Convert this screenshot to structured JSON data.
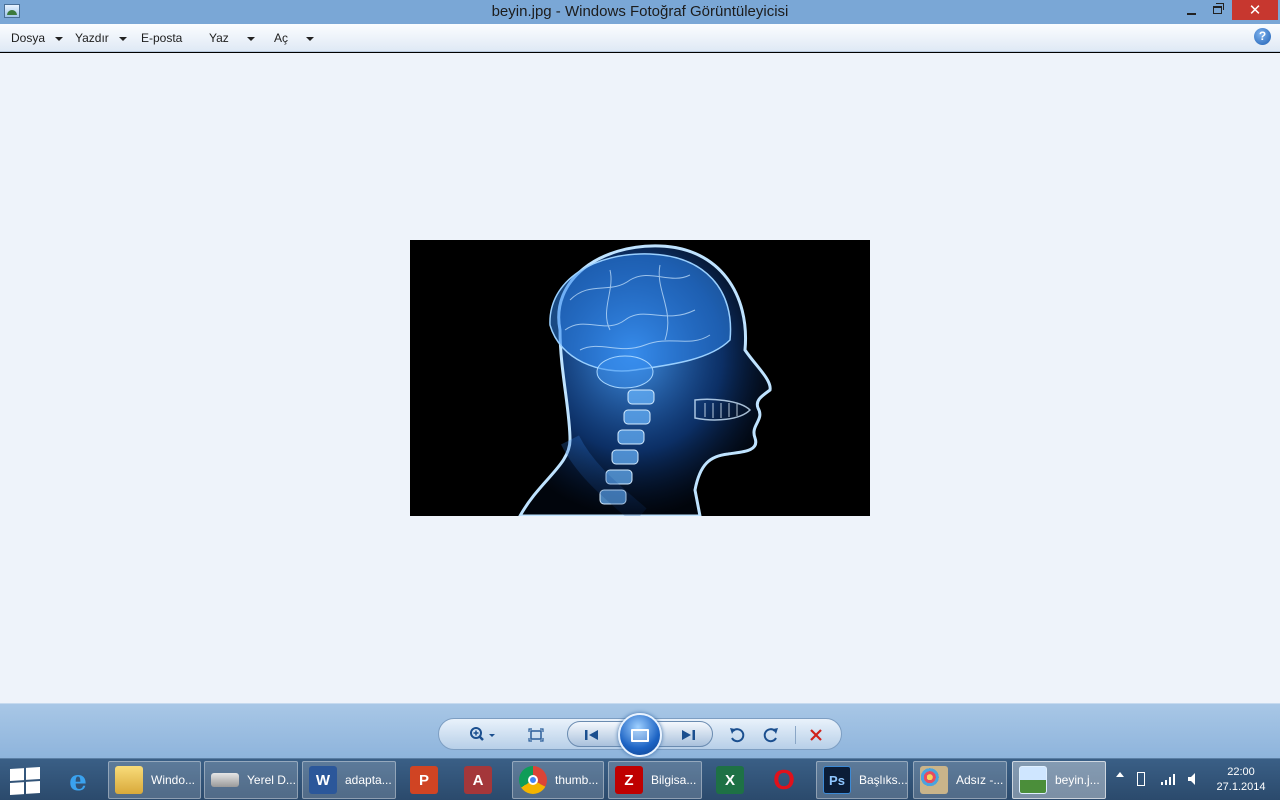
{
  "window": {
    "title": "beyin.jpg - Windows Fotoğraf Görüntüleyicisi",
    "icon": "photo-viewer-icon",
    "controls": [
      "minimize-icon",
      "restore-icon",
      "close-icon"
    ]
  },
  "menu": {
    "items": [
      {
        "label": "Dosya",
        "has_dropdown": true
      },
      {
        "label": "Yazdır",
        "has_dropdown": true
      },
      {
        "label": "E-posta",
        "has_dropdown": false
      },
      {
        "label": "Yaz",
        "has_dropdown": true
      },
      {
        "label": "Aç",
        "has_dropdown": true
      }
    ],
    "help_icon": "help-icon",
    "help_glyph": "?"
  },
  "image": {
    "subject": "x-ray-head-brain"
  },
  "controls": {
    "buttons": [
      "zoom-icon",
      "actual-size-icon",
      "previous-icon",
      "slideshow-icon",
      "next-icon",
      "rotate-left-icon",
      "rotate-right-icon",
      "delete-icon"
    ]
  },
  "taskbar": {
    "items": [
      {
        "label": "",
        "icon": "internet-explorer-icon"
      },
      {
        "label": "Windo...",
        "icon": "folder-icon"
      },
      {
        "label": "Yerel D...",
        "icon": "drive-icon"
      },
      {
        "label": "adapta...",
        "icon": "word-icon",
        "glyph": "W"
      },
      {
        "label": "",
        "icon": "powerpoint-icon",
        "glyph": "P"
      },
      {
        "label": "",
        "icon": "access-icon",
        "glyph": "A"
      },
      {
        "label": "thumb...",
        "icon": "chrome-icon"
      },
      {
        "label": "Bilgisa...",
        "icon": "filezilla-icon",
        "glyph": "Z"
      },
      {
        "label": "",
        "icon": "excel-icon",
        "glyph": "X"
      },
      {
        "label": "",
        "icon": "opera-icon",
        "glyph": "O"
      },
      {
        "label": "Başlıks...",
        "icon": "photoshop-icon",
        "glyph": "Ps"
      },
      {
        "label": "Adsız -...",
        "icon": "paint-icon"
      },
      {
        "label": "beyin.j...",
        "icon": "photo-viewer-icon"
      }
    ],
    "clock_time": "22:00",
    "clock_date": "27.1.2014",
    "tray_icons": [
      "show-hidden-icons-icon",
      "battery-icon",
      "network-icon",
      "volume-icon"
    ]
  },
  "colors": {
    "titlebar": "#7aa7d6",
    "viewer_background": "#eef3fa",
    "close_button": "#c7372f",
    "taskbar": "#2f5075"
  }
}
